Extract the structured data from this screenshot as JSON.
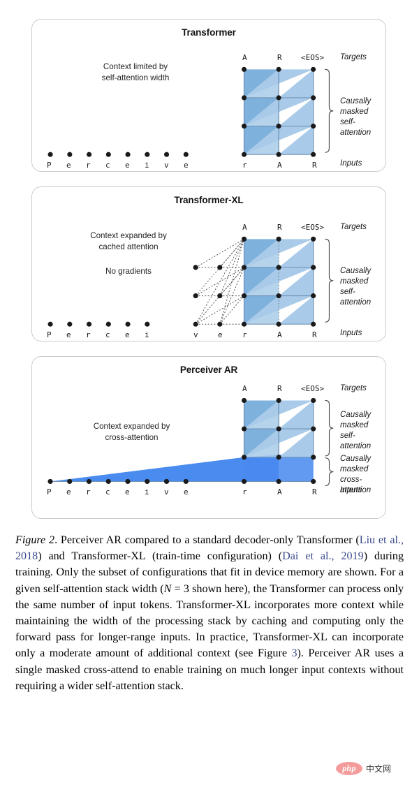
{
  "figure": {
    "panels": [
      {
        "id": "transformer",
        "title": "Transformer",
        "note": "Context limited by\nself-attention width",
        "input_tokens": [
          "P",
          "e",
          "r",
          "c",
          "e",
          "i",
          "v",
          "e",
          "r",
          "A",
          "R"
        ],
        "target_tokens": [
          "A",
          "R",
          "<EOS>"
        ],
        "targets_label": "Targets",
        "inputs_label": "Inputs",
        "brace_labels": [
          "Causally\nmasked\nself-attention"
        ],
        "stack_rows": 4,
        "attended_columns": 3,
        "cached_columns": 0
      },
      {
        "id": "transformer-xl",
        "title": "Transformer-XL",
        "note": "Context expanded by\ncached attention\n\nNo gradients",
        "note_line1": "Context expanded by\ncached attention",
        "note_line2": "No gradients",
        "input_tokens": [
          "P",
          "e",
          "r",
          "c",
          "e",
          "i",
          "v",
          "e",
          "r",
          "A",
          "R"
        ],
        "target_tokens": [
          "A",
          "R",
          "<EOS>"
        ],
        "targets_label": "Targets",
        "inputs_label": "Inputs",
        "brace_labels": [
          "Causally\nmasked\nself-attention"
        ],
        "stack_rows": 4,
        "attended_columns": 3,
        "cached_columns": 2
      },
      {
        "id": "perceiver-ar",
        "title": "Perceiver AR",
        "note": "Context expanded by\ncross-attention",
        "input_tokens": [
          "P",
          "e",
          "r",
          "c",
          "e",
          "i",
          "v",
          "e",
          "r",
          "A",
          "R"
        ],
        "target_tokens": [
          "A",
          "R",
          "<EOS>"
        ],
        "targets_label": "Targets",
        "inputs_label": "Inputs",
        "brace_labels": [
          "Causally\nmasked\nself-attention",
          "Causally\nmasked\ncross-attention"
        ],
        "stack_rows": 3,
        "attended_columns": 3,
        "cross_attention_span": 11
      }
    ],
    "colors": {
      "attention_light": "#a9cbe9",
      "attention_dark": "#7eb1dc",
      "cross_attention": "#4a8bf0",
      "cross_attention_light": "#6c9ff2",
      "dot": "#1a1a1a",
      "grid_line": "#6f93b8",
      "panel_border": "#cccccc",
      "dashed_line": "#555555"
    }
  },
  "caption": {
    "label": "Figure 2",
    "label_suffix": ".",
    "segments": [
      {
        "text": " Perceiver AR compared to a standard decoder-only Transformer (",
        "kind": "plain"
      },
      {
        "text": "Liu et al., 2018",
        "kind": "cite"
      },
      {
        "text": ") and Transformer-XL (train-time configuration) (",
        "kind": "plain"
      },
      {
        "text": "Dai et al., 2019",
        "kind": "cite"
      },
      {
        "text": ") during training.  Only the subset of configurations that fit in device memory are shown.  For a given self-attention stack width (",
        "kind": "plain"
      },
      {
        "text": "N",
        "kind": "math"
      },
      {
        "text": " = 3 shown here), the Transformer can process only the same number of input tokens.  Transformer-XL incorporates more context while maintaining the width of the processing stack by caching and computing only the forward pass for longer-range inputs.  In practice, Transformer-XL can incorporate only a moderate amount of additional context (see Figure ",
        "kind": "plain"
      },
      {
        "text": "3",
        "kind": "cite"
      },
      {
        "text": ").  Perceiver AR uses a single masked cross-attend to enable training on much longer input contexts without requiring a wider self-attention stack.",
        "kind": "plain"
      }
    ]
  },
  "watermark": {
    "logo_text": "php",
    "site_text": "中文网"
  }
}
